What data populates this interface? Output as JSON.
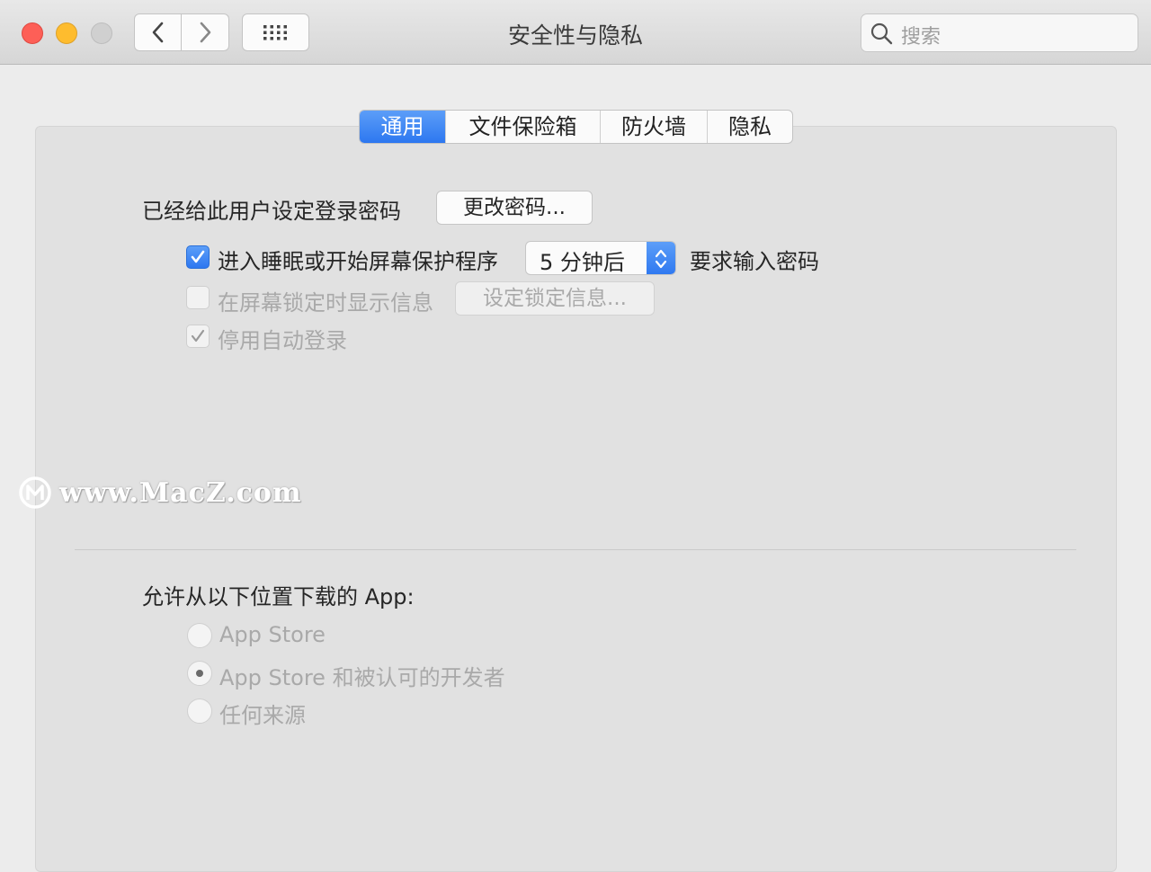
{
  "window": {
    "title": "安全性与隐私",
    "search_placeholder": "搜索"
  },
  "toolbar": {
    "back_icon": "chevron-left-icon",
    "forward_icon": "chevron-right-icon",
    "grid_icon": "grid-icon"
  },
  "tabs": [
    {
      "label": "通用",
      "active": true
    },
    {
      "label": "文件保险箱",
      "active": false
    },
    {
      "label": "防火墙",
      "active": false
    },
    {
      "label": "隐私",
      "active": false
    }
  ],
  "general": {
    "password_set_label": "已经给此用户设定登录密码",
    "change_password_button": "更改密码...",
    "require_password": {
      "checked": true,
      "label": "进入睡眠或开始屏幕保护程序",
      "delay_value": "5 分钟后",
      "suffix": "要求输入密码"
    },
    "show_message": {
      "checked": false,
      "enabled": false,
      "label": "在屏幕锁定时显示信息",
      "button": "设定锁定信息..."
    },
    "disable_auto_login": {
      "checked": true,
      "enabled": false,
      "label": "停用自动登录"
    }
  },
  "downloads": {
    "heading": "允许从以下位置下载的 App:",
    "options": [
      {
        "label": "App Store",
        "selected": false
      },
      {
        "label": "App Store 和被认可的开发者",
        "selected": true
      },
      {
        "label": "任何来源",
        "selected": false
      }
    ]
  },
  "watermark": {
    "text": "www.MacZ.com"
  },
  "colors": {
    "accent": "#2d77f0",
    "close": "#fd5f57",
    "minimize": "#febc2e"
  }
}
